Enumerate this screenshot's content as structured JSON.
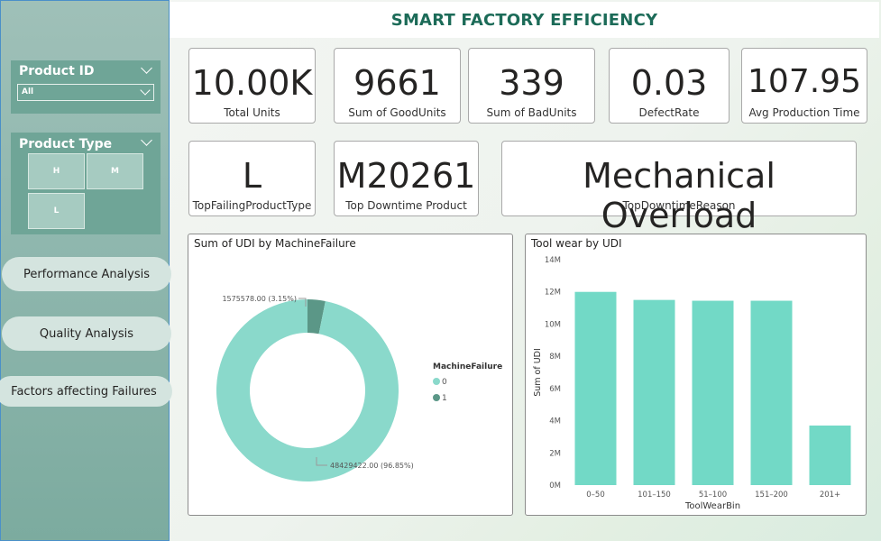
{
  "header": {
    "title": "SMART FACTORY EFFICIENCY"
  },
  "sidebar": {
    "product_id": {
      "label": "Product ID",
      "selected": "All"
    },
    "product_type": {
      "label": "Product Type",
      "options": [
        "H",
        "M",
        "L"
      ]
    },
    "nav": [
      "Performance Analysis",
      "Quality Analysis",
      "Factors affecting Failures"
    ]
  },
  "kpis": [
    {
      "value": "10.00K",
      "label": "Total Units"
    },
    {
      "value": "9661",
      "label": "Sum of GoodUnits"
    },
    {
      "value": "339",
      "label": "Sum of BadUnits"
    },
    {
      "value": "0.03",
      "label": "DefectRate"
    },
    {
      "value": "107.95",
      "label": "Avg Production Time"
    },
    {
      "value": "L",
      "label": "TopFailingProductType"
    },
    {
      "value": "M20261",
      "label": "Top Downtime Product"
    },
    {
      "value": "Mechanical Overload",
      "label": "TopDowntimeReason"
    }
  ],
  "colors": {
    "accent": "#8ad9cb",
    "dark_slice": "#5b9787",
    "title": "#1c6b58",
    "sidebar": "#8fb7ae"
  },
  "chart_data": [
    {
      "type": "pie",
      "title": "Sum of UDI by MachineFailure",
      "legend_title": "MachineFailure",
      "legend_position": "right",
      "categories": [
        "0",
        "1"
      ],
      "values": [
        48429422.0,
        1575578.0
      ],
      "data_labels": [
        "48429422.00 (96.85%)",
        "1575578.00 (3.15%)"
      ],
      "colors": [
        "#8ad9cb",
        "#5b9787"
      ]
    },
    {
      "type": "bar",
      "title": "Tool wear by UDI",
      "xlabel": "ToolWearBin",
      "ylabel": "Sum of UDI",
      "categories": [
        "0–50",
        "101–150",
        "51–100",
        "151–200",
        "201+"
      ],
      "values": [
        12000000,
        11500000,
        11450000,
        11450000,
        3700000
      ],
      "ylim": [
        0,
        14000000
      ],
      "ticks": [
        "0M",
        "2M",
        "4M",
        "6M",
        "8M",
        "10M",
        "12M",
        "14M"
      ],
      "grid": false,
      "color": "#72d9c6"
    }
  ]
}
